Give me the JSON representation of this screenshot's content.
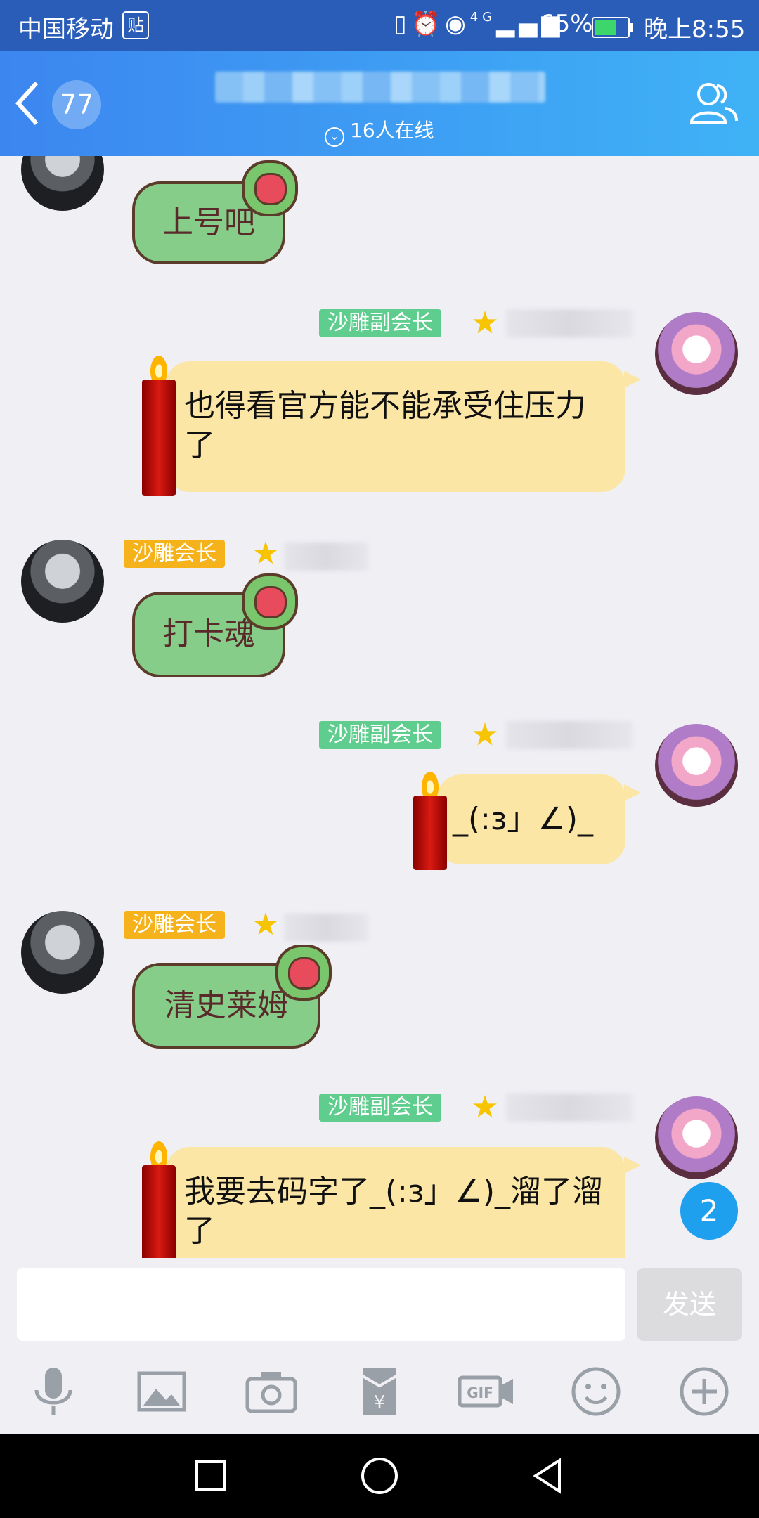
{
  "status_bar": {
    "carrier": "中国移动",
    "carrier_badge": "贴",
    "network": "4G",
    "battery": "65%",
    "time": "晚上8:55",
    "battery_level": 0.65
  },
  "header": {
    "badge_count": "77",
    "online": "16人在线"
  },
  "messages": [
    {
      "side": "left",
      "sticker_text": "上号吧"
    },
    {
      "side": "right",
      "title": "沙雕副会长",
      "text": "也得看官方能不能承受住压力了"
    },
    {
      "side": "left",
      "title": "沙雕会长",
      "sticker_text": "打卡魂"
    },
    {
      "side": "right",
      "title": "沙雕副会长",
      "text": "_(:з」∠)_"
    },
    {
      "side": "left",
      "title": "沙雕会长",
      "sticker_text": "清史莱姆"
    },
    {
      "side": "right",
      "title": "沙雕副会长",
      "text": "我要去码字了_(:з」∠)_溜了溜了"
    }
  ],
  "unread_count": "2",
  "input": {
    "value": "",
    "send_label": "发送"
  },
  "toolbar_icons": [
    "microphone-icon",
    "image-icon",
    "camera-icon",
    "red-packet-icon",
    "gif-icon",
    "emoji-icon",
    "plus-icon"
  ],
  "colors": {
    "header_start": "#3c86f0",
    "header_end": "#3fb2f6",
    "bubble_yellow": "#fbe6a6",
    "tag_green": "#5fcd8e",
    "tag_orange": "#f5b21b",
    "unread_blue": "#1ea0ef"
  }
}
